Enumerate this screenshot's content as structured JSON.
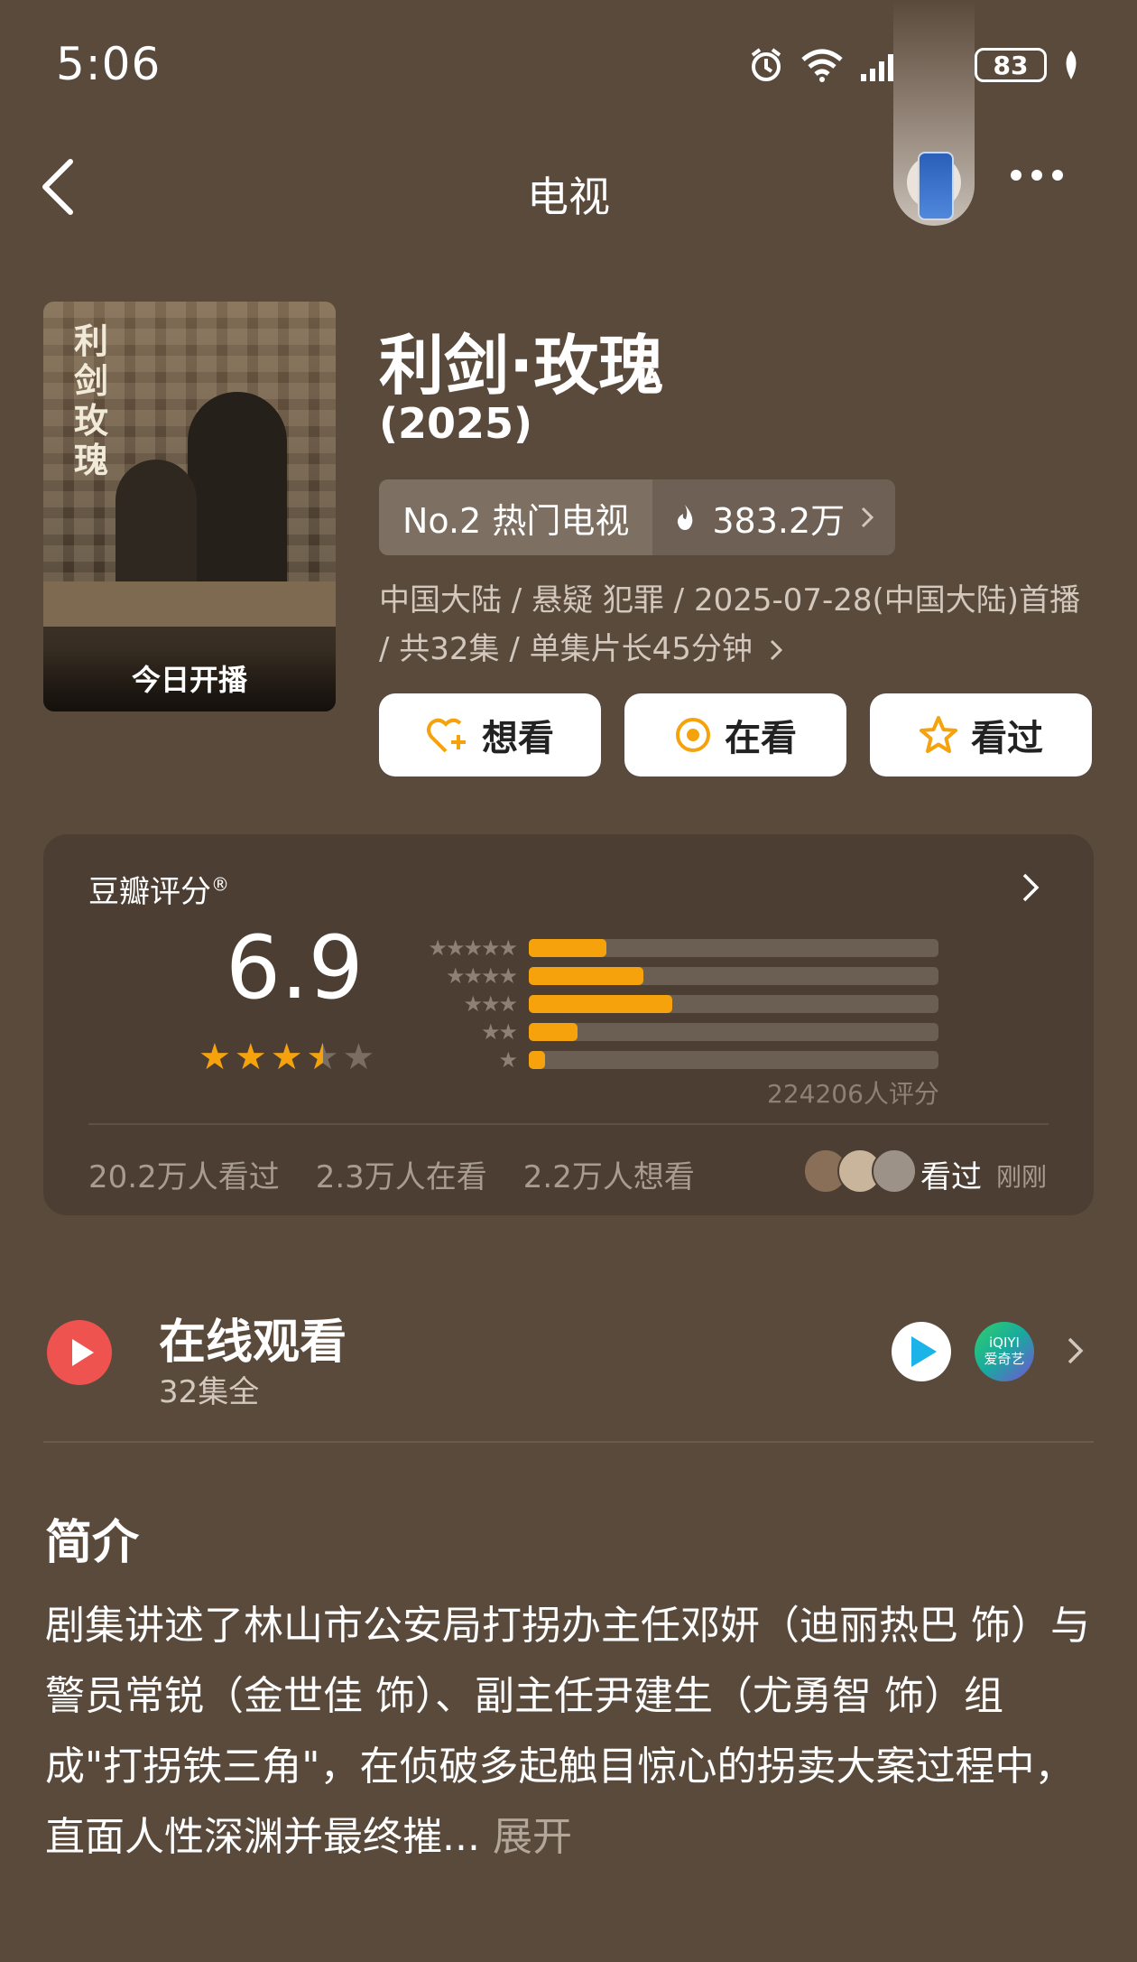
{
  "status": {
    "time": "5:06",
    "battery": "83"
  },
  "nav": {
    "title": "电视"
  },
  "poster": {
    "title": "利剑玫瑰",
    "caption": "今日开播"
  },
  "show": {
    "title": "利剑·玫瑰",
    "year": "(2025)",
    "rank_label": "No.2 热门电视",
    "heat": "383.2万",
    "meta": "中国大陆 / 悬疑 犯罪 / 2025-07-28(中国大陆)首播 / 共32集 / 单集片长45分钟"
  },
  "actions": {
    "want": "想看",
    "watching": "在看",
    "watched": "看过"
  },
  "rating": {
    "label": "豆瓣评分",
    "score": "6.9",
    "stars": 3.5,
    "distribution": [
      {
        "stars": 5,
        "fraction": 0.19
      },
      {
        "stars": 4,
        "fraction": 0.28
      },
      {
        "stars": 3,
        "fraction": 0.35
      },
      {
        "stars": 2,
        "fraction": 0.12
      },
      {
        "stars": 1,
        "fraction": 0.04
      }
    ],
    "count": "224206人评分",
    "watched": "20.2万人看过",
    "watching": "2.3万人在看",
    "want": "2.2万人想看",
    "friend_action": "看过",
    "friend_time": "刚刚"
  },
  "watch": {
    "title": "在线观看",
    "subtitle": "32集全",
    "iqiyi_line1": "iQIYI",
    "iqiyi_line2": "爱奇艺"
  },
  "synopsis": {
    "heading": "简介",
    "text": "剧集讲述了林山市公安局打拐办主任邓妍（迪丽热巴 饰）与警员常锐（金世佳 饰）、副主任尹建生（尤勇智 饰）组成\"打拐铁三角\"，在侦破多起触目惊心的拐卖大案过程中，直面人性深渊并最终摧...",
    "expand": "展开"
  },
  "colors": {
    "background": "#5a4a3c",
    "star": "#f5a20c",
    "accent_red": "#ef5350"
  }
}
